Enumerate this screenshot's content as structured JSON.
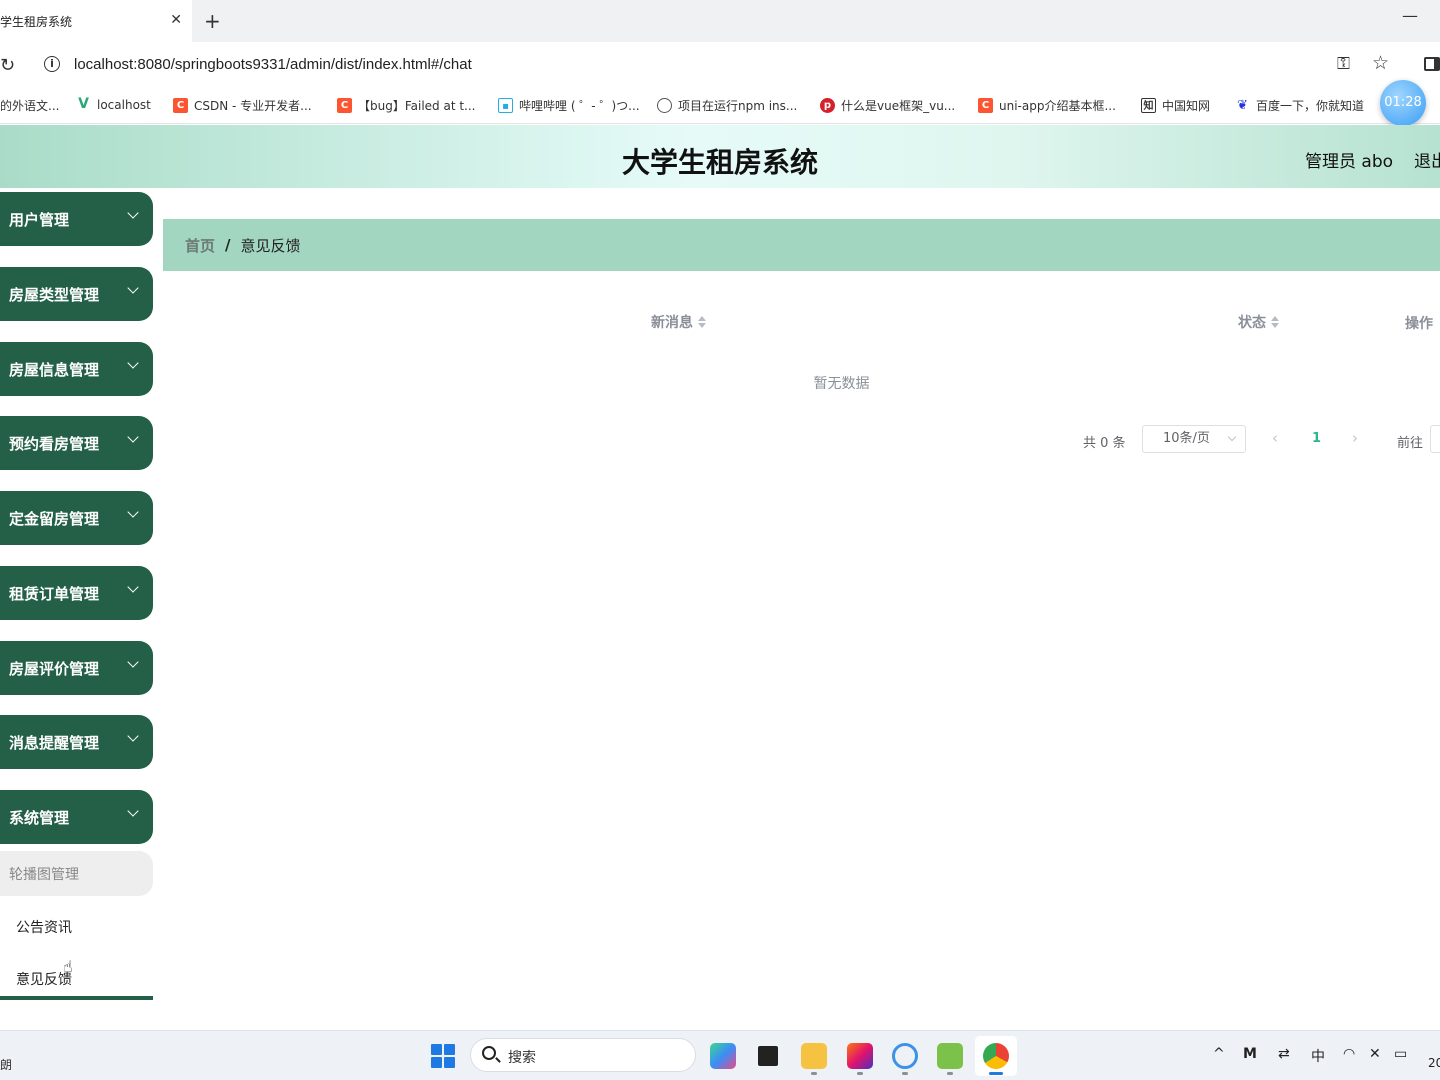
{
  "browser": {
    "tab_title": "学生租房系统",
    "url": "localhost:8080/springboots9331/admin/dist/index.html#/chat",
    "bookmarks": [
      "的外语文...",
      "localhost",
      "CSDN - 专业开发者...",
      "【bug】Failed at t...",
      "哔哩哔哩 ( ゜- ゜)つ...",
      "项目在运行npm ins...",
      "什么是vue框架_vu...",
      "uni-app介绍基本框...",
      "中国知网",
      "百度一下，你就知道"
    ],
    "timer": "01:28"
  },
  "header": {
    "title": "大学生租房系统",
    "user": "管理员 abo",
    "logout": "退出"
  },
  "sidebar": {
    "items": [
      {
        "label": "用户管理"
      },
      {
        "label": "房屋类型管理"
      },
      {
        "label": "房屋信息管理"
      },
      {
        "label": "预约看房管理"
      },
      {
        "label": "定金留房管理"
      },
      {
        "label": "租赁订单管理"
      },
      {
        "label": "房屋评价管理"
      },
      {
        "label": "消息提醒管理"
      },
      {
        "label": "系统管理"
      }
    ],
    "sub_items": [
      "轮播图管理",
      "公告资讯",
      "意见反馈"
    ]
  },
  "breadcrumb": {
    "home": "首页",
    "separator": "/",
    "current": "意见反馈"
  },
  "table": {
    "columns": [
      "新消息",
      "状态",
      "操作"
    ],
    "empty_text": "暂无数据"
  },
  "pagination": {
    "total": "共 0 条",
    "page_size": "10条/页",
    "current_page": "1",
    "goto_label": "前往"
  },
  "taskbar": {
    "left_text": "朗",
    "search_placeholder": "搜索",
    "ime": "中",
    "clock_partial": "20"
  },
  "colors": {
    "sidebar": "#236047",
    "breadcrumb_bg": "#a3d6c0",
    "accent": "#2fb58d"
  }
}
